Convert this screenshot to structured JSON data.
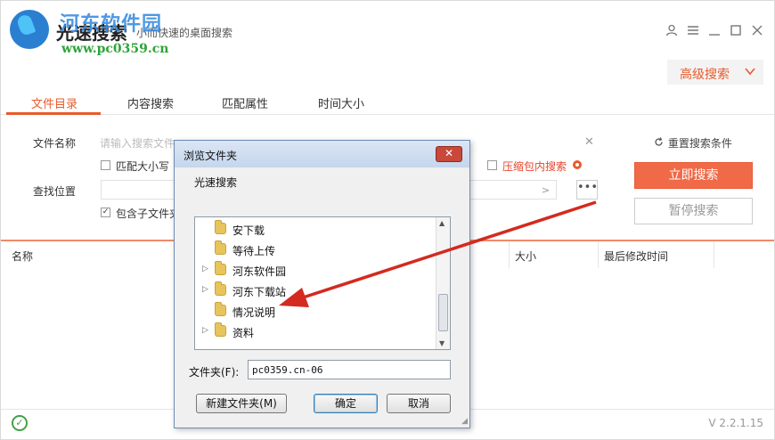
{
  "app": {
    "title": "光速搜索",
    "subtitle": "小而快速的桌面搜索",
    "watermark_title": "河东软件园",
    "watermark_url": "www.pc0359.cn",
    "version": "V 2.2.1.15"
  },
  "header": {
    "advanced_label": "高级搜索",
    "advanced_icon": "chevron-down-icon",
    "window_icons": [
      "user-icon",
      "menu-icon",
      "minimize-icon",
      "maximize-icon",
      "close-icon"
    ]
  },
  "tabs": [
    {
      "label": "文件目录",
      "active": true
    },
    {
      "label": "内容搜索",
      "active": false
    },
    {
      "label": "匹配属性",
      "active": false
    },
    {
      "label": "时间大小",
      "active": false
    }
  ],
  "form": {
    "filename_label": "文件名称",
    "filename_placeholder": "请输入搜索文件",
    "match_case_label": "匹配大小写",
    "match_case_checked": false,
    "archive_search_label": "压缩包内搜索",
    "archive_search_checked": false,
    "location_label": "查找位置",
    "location_value": "",
    "include_sub_label": "包含子文件夹",
    "include_sub_checked": true,
    "more_label": "•••"
  },
  "actions": {
    "reset_label": "重置搜索条件",
    "search_label": "立即搜索",
    "pause_label": "暂停搜索"
  },
  "results": {
    "columns": [
      "名称",
      "大小",
      "最后修改时间"
    ]
  },
  "dialog": {
    "title": "浏览文件夹",
    "close_label": "✕",
    "description": "光速搜索",
    "tree": [
      {
        "label": "安下载",
        "expandable": false
      },
      {
        "label": "等待上传",
        "expandable": false
      },
      {
        "label": "河东软件园",
        "expandable": true
      },
      {
        "label": "河东下载站",
        "expandable": true
      },
      {
        "label": "情况说明",
        "expandable": false
      },
      {
        "label": "资料",
        "expandable": true
      }
    ],
    "folder_label": "文件夹(F):",
    "folder_value": "pc0359.cn-06",
    "new_folder_label": "新建文件夹(M)",
    "ok_label": "确定",
    "cancel_label": "取消"
  },
  "colors": {
    "accent": "#e85b2d",
    "search_button": "#f06a48",
    "annotation_arrow": "#d42a20"
  }
}
